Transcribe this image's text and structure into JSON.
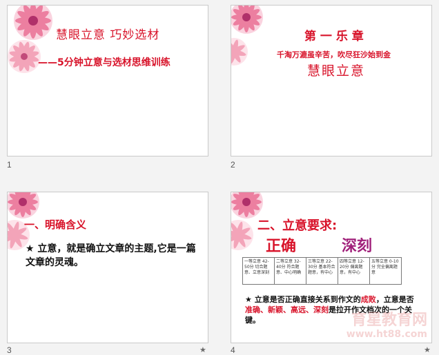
{
  "slides": [
    {
      "number": "1",
      "title": "慧眼立意 巧妙选材",
      "subtitle": "——5分钟立意与选材思维训练"
    },
    {
      "number": "2",
      "title": "第 一 乐 章",
      "line": "千淘万漉虽辛苦，吹尽狂沙始到金",
      "subtitle": "慧眼立意"
    },
    {
      "number": "3",
      "heading": "一、明确含义",
      "body": "★ 立意，就是确立文章的主题,它是一篇文章的灵魂。",
      "star": "★"
    },
    {
      "number": "4",
      "heading": "二、立意要求:",
      "word1": "正确",
      "word2": "深刻",
      "table": [
        "一等立意 42-50分 切合题意、立意深刻",
        "二等立意 32-40分 符合题意、中心明确",
        "三等立意 22-30分 基本符合题意，有中心",
        "四等立意 12-20分 偏离题意，有中心",
        "五等立意 0-10分 完全偏离题意"
      ],
      "body_pre": "★ 立意是否正确直接关系到作文的",
      "body_red1": "成败",
      "body_mid": "，立意是否",
      "body_red2": "准确、新颖、高远、深刻",
      "body_post": "是拉开作文档次的一个关键。",
      "star": "★"
    }
  ],
  "watermark": {
    "name": "育星教育网",
    "url": "www.ht88.com"
  },
  "colors": {
    "accent": "#d8132a",
    "purple": "#a0207a",
    "flower": "#f07a9a"
  }
}
